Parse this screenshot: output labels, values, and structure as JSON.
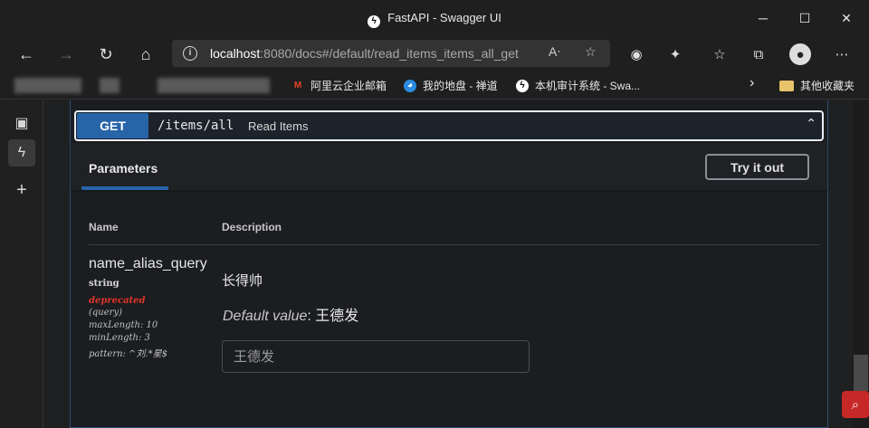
{
  "window": {
    "title": "FastAPI - Swagger UI",
    "app_icon": "fastapi-icon",
    "controls": {
      "minimize": "─",
      "maximize": "☐",
      "close": "✕"
    }
  },
  "address_bar": {
    "url_host": "localhost",
    "url_rest": ":8080/docs#/default/read_items_items_all_get"
  },
  "bookmarks": [
    {
      "label": "阿里云企业邮箱",
      "icon": "mail-icon",
      "icon_glyph": "M",
      "color": "#e8412c"
    },
    {
      "label": "我的地盘 - 禅道",
      "icon": "zentao-icon",
      "icon_glyph": "◕",
      "color": "#2a8be0"
    },
    {
      "label": "本机审计系统 - Swa...",
      "icon": "fastapi-icon",
      "icon_glyph": "ϟ",
      "color": "#ffffff"
    }
  ],
  "bookmarks_more": "›",
  "other_bookmarks": "其他收藏夹",
  "operation": {
    "method": "GET",
    "path": "/items/all",
    "summary": "Read Items",
    "method_color": "#2864a8"
  },
  "parameters": {
    "tab_label": "Parameters",
    "try_button": "Try it out",
    "headers": {
      "name": "Name",
      "description": "Description"
    },
    "items": [
      {
        "name": "name_alias_query",
        "type": "string",
        "deprecated": "deprecated",
        "in": "(query)",
        "max_length": "maxLength: 10",
        "min_length": "minLength: 3",
        "pattern": "pattern: ^刘.*星$",
        "description": "长得帅",
        "default_label": "Default value",
        "default_value": ": 王德发",
        "input_placeholder": "王德发"
      }
    ]
  }
}
